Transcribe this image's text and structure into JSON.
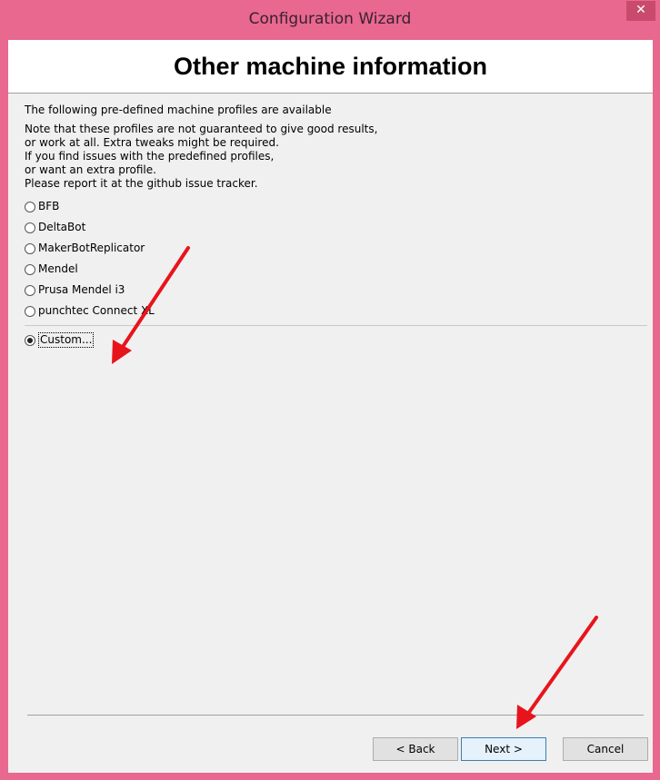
{
  "window": {
    "title": "Configuration Wizard",
    "close_glyph": "✕"
  },
  "page": {
    "heading": "Other machine information",
    "intro": "The following pre-defined machine profiles are available",
    "note_lines": [
      "Note that these profiles are not guaranteed to give good results,",
      "or work at all. Extra tweaks might be required.",
      "If you find issues with the predefined profiles,",
      "or want an extra profile.",
      "Please report it at the github issue tracker."
    ]
  },
  "profiles": [
    {
      "label": "BFB",
      "selected": false
    },
    {
      "label": "DeltaBot",
      "selected": false
    },
    {
      "label": "MakerBotReplicator",
      "selected": false
    },
    {
      "label": "Mendel",
      "selected": false
    },
    {
      "label": "Prusa Mendel i3",
      "selected": false
    },
    {
      "label": "punchtec Connect XL",
      "selected": false
    }
  ],
  "custom_option": {
    "label": "Custom...",
    "selected": true
  },
  "buttons": {
    "back": "< Back",
    "next": "Next >",
    "cancel": "Cancel"
  },
  "colors": {
    "title_bar": "#e8688f",
    "annotation_arrow": "#e8141c"
  },
  "annotations": {
    "arrows": [
      "arrow-to-custom-option",
      "arrow-to-next-button"
    ]
  }
}
